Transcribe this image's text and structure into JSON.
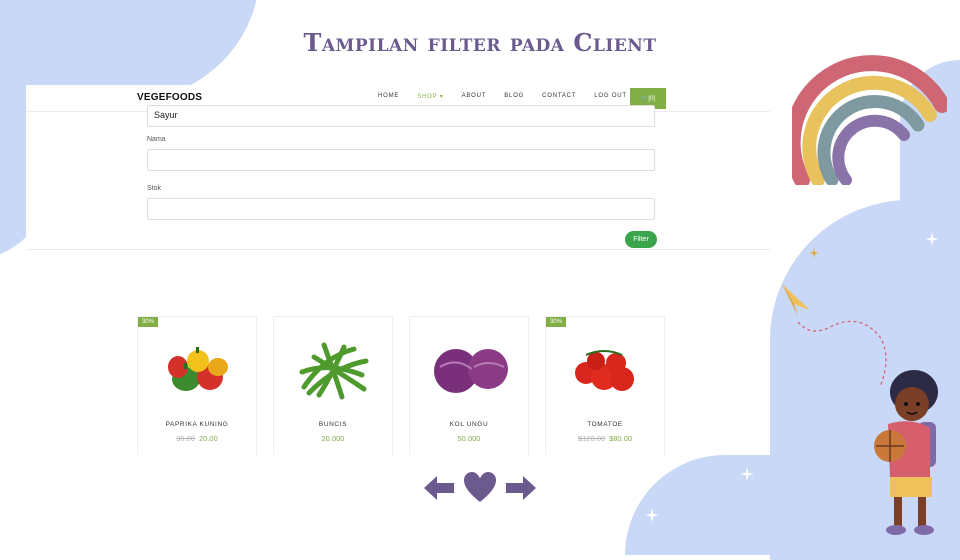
{
  "slide": {
    "title": "Tampilan filter pada Client"
  },
  "navbar": {
    "brand": "VEGEFOODS",
    "links": [
      "HOME",
      "SHOP ▾",
      "ABOUT",
      "BLOG",
      "CONTACT",
      "LOG OUT"
    ],
    "active_link": "SHOP",
    "cart": "🛒[0]"
  },
  "filter_form": {
    "kategori_value": "Sayur",
    "nama_label": "Nama",
    "nama_value": "",
    "stok_label": "Stok",
    "stok_value": "",
    "filter_button": "Filter"
  },
  "products": [
    {
      "name": "PAPRIKA KUNING",
      "badge": "30%",
      "old_price": "30.00",
      "price": "20.00"
    },
    {
      "name": "BUNCIS",
      "badge": "",
      "old_price": "",
      "price": "20.000"
    },
    {
      "name": "KOL UNGU",
      "badge": "",
      "old_price": "",
      "price": "50.000"
    },
    {
      "name": "TOMATOE",
      "badge": "30%",
      "old_price": "$120.00",
      "price": "$80.00"
    }
  ],
  "colors": {
    "accent": "#82ae46",
    "title": "#6b5a8e",
    "blob": "#c9d8f7",
    "filter_button": "#3aa54a"
  },
  "icons": [
    "arrow-left-icon",
    "heart-icon",
    "arrow-right-icon",
    "rainbow-icon",
    "paper-plane-icon",
    "sparkle-icon"
  ]
}
